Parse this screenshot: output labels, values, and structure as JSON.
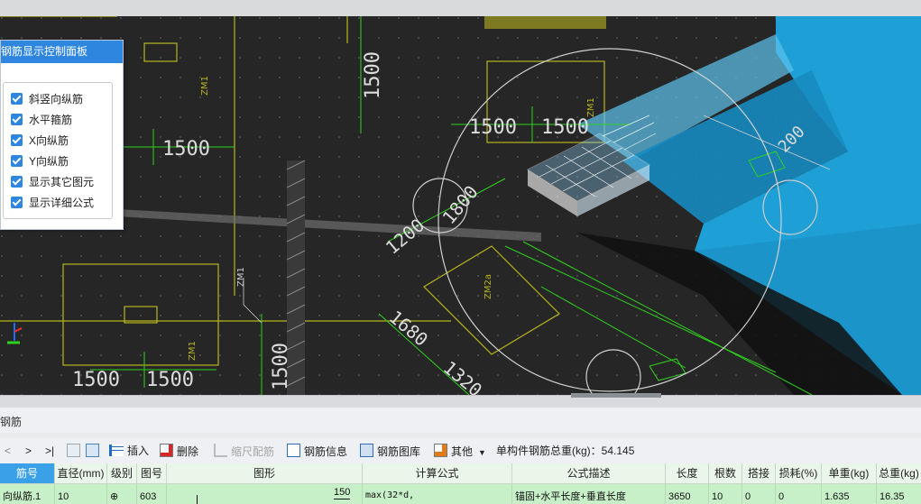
{
  "panel": {
    "title": "钢筋显示控制面板",
    "options": [
      {
        "label": "斜竖向纵筋",
        "checked": true
      },
      {
        "label": "水平箍筋",
        "checked": true
      },
      {
        "label": "X向纵筋",
        "checked": true
      },
      {
        "label": "Y向纵筋",
        "checked": true
      },
      {
        "label": "显示其它图元",
        "checked": true
      },
      {
        "label": "显示详细公式",
        "checked": true
      }
    ]
  },
  "cad": {
    "dims": [
      "1500",
      "1500",
      "1500",
      "1500",
      "1500",
      "1500",
      "1500",
      "1200",
      "1800",
      "1680",
      "1320",
      "200"
    ],
    "tags": [
      "ZM1",
      "ZM1",
      "ZM1",
      "ZM2a",
      "ZM1"
    ]
  },
  "section": {
    "title": "钢筋"
  },
  "toolbar": {
    "nav": [
      "<",
      ">",
      ">|"
    ],
    "insert": "插入",
    "delete": "删除",
    "scale": "缩尺配筋",
    "info": "钢筋信息",
    "library": "钢筋图库",
    "other": "其他",
    "total": "单构件钢筋总重(kg)：54.145"
  },
  "table": {
    "headers": [
      "筋号",
      "直径(mm)",
      "级别",
      "图号",
      "图形",
      "计算公式",
      "公式描述",
      "长度",
      "根数",
      "搭接",
      "损耗(%)",
      "单重(kg)",
      "总重(kg)"
    ],
    "row": {
      "name": "向纵筋.1",
      "diameter": "10",
      "grade": "⊕",
      "figure": "603",
      "shape_top": "150",
      "formula": "max(32*d,",
      "desc": "锚固+水平长度+垂直长度",
      "length": "3650",
      "count": "10",
      "lap": "0",
      "loss": "0",
      "unit_weight": "1.635",
      "total_weight": "16.35"
    }
  },
  "colors": {
    "accent": "#2e86de",
    "slab": "#1e9fd6",
    "dim": "#2fd11f",
    "outline": "#b7b51e"
  }
}
